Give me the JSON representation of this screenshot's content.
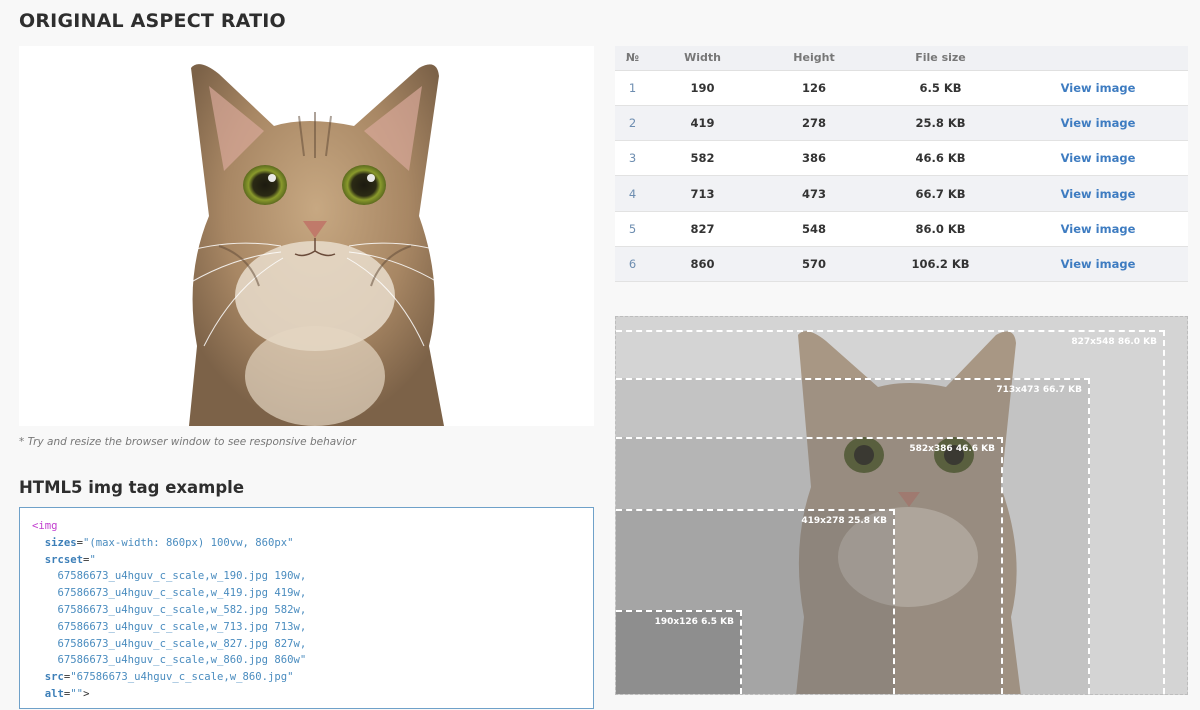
{
  "page": {
    "title": "ORIGINAL ASPECT RATIO",
    "resize_note": "* Try and resize the browser window to see responsive behavior",
    "code_title": "HTML5 img tag example"
  },
  "code": {
    "tag_open": "<img",
    "sizes_attr": "sizes",
    "sizes_value": "\"(max-width: 860px) 100vw, 860px\"",
    "srcset_attr": "srcset",
    "srcset_quote": "\"",
    "srcset_lines": [
      "67586673_u4hguv_c_scale,w_190.jpg 190w,",
      "67586673_u4hguv_c_scale,w_419.jpg 419w,",
      "67586673_u4hguv_c_scale,w_582.jpg 582w,",
      "67586673_u4hguv_c_scale,w_713.jpg 713w,",
      "67586673_u4hguv_c_scale,w_827.jpg 827w,",
      "67586673_u4hguv_c_scale,w_860.jpg 860w\""
    ],
    "src_attr": "src",
    "src_value": "\"67586673_u4hguv_c_scale,w_860.jpg\"",
    "alt_attr": "alt",
    "alt_value": "\"\"",
    "tag_close": ">"
  },
  "table": {
    "headers": [
      "№",
      "Width",
      "Height",
      "File size",
      ""
    ],
    "link_label": "View image",
    "rows": [
      {
        "n": "1",
        "width": "190",
        "height": "126",
        "size": "6.5 KB"
      },
      {
        "n": "2",
        "width": "419",
        "height": "278",
        "size": "25.8 KB"
      },
      {
        "n": "3",
        "width": "582",
        "height": "386",
        "size": "46.6 KB"
      },
      {
        "n": "4",
        "width": "713",
        "height": "473",
        "size": "66.7 KB"
      },
      {
        "n": "5",
        "width": "827",
        "height": "548",
        "size": "86.0 KB"
      },
      {
        "n": "6",
        "width": "860",
        "height": "570",
        "size": "106.2 KB"
      }
    ]
  },
  "comparison": {
    "labels": [
      "827x548 86.0 KB",
      "713x473 66.7 KB",
      "582x386 46.6 KB",
      "419x278 25.8 KB",
      "190x126 6.5 KB"
    ]
  },
  "colors": {
    "link": "#3e7cc1",
    "code_tag": "#c13ecf",
    "code_attr": "#3d7fb8",
    "code_border": "#6fa1c9"
  }
}
